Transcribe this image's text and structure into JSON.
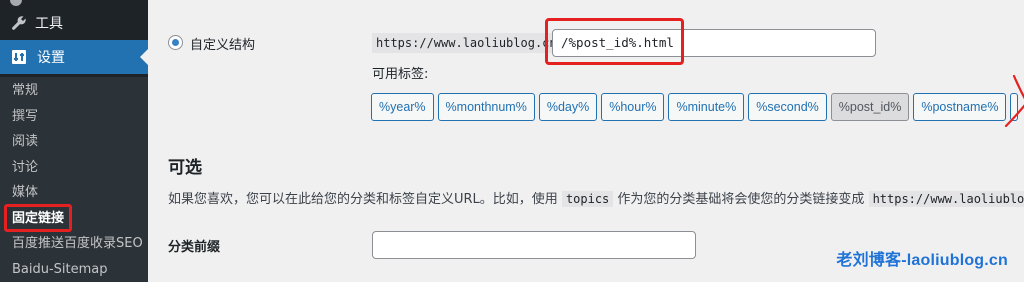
{
  "sidebar": {
    "tools_label": "工具",
    "settings_label": "设置",
    "items": [
      {
        "label": "常规"
      },
      {
        "label": "撰写"
      },
      {
        "label": "阅读"
      },
      {
        "label": "讨论"
      },
      {
        "label": "媒体"
      },
      {
        "label": "固定链接"
      },
      {
        "label": "百度推送百度收录SEO"
      },
      {
        "label": "Baidu-Sitemap"
      }
    ],
    "current_index": 5
  },
  "permalink": {
    "option_label": "自定义结构",
    "url_prefix": "https://www.laoliublog.cn",
    "structure_value": "/%post_id%.html",
    "tags_label": "可用标签:",
    "tags": [
      "%year%",
      "%monthnum%",
      "%day%",
      "%hour%",
      "%minute%",
      "%second%",
      "%post_id%",
      "%postname%"
    ],
    "active_tag": "%post_id%"
  },
  "optional": {
    "title": "可选",
    "desc_before": "如果您喜欢，您可以在此给您的分类和标签自定义URL。比如，使用 ",
    "desc_code1": "topics",
    "desc_middle": " 作为您的分类基础将会使您的分类链接变成 ",
    "desc_code2": "https://www.laoliublog.cn/topics/uncategorized/",
    "category_base_label": "分类前缀",
    "category_base_value": ""
  },
  "watermark": "老刘博客-laoliublog.cn",
  "colors": {
    "sidebar_bg": "#1d2327",
    "active_menu": "#2271b1",
    "annotation_red": "#e52020",
    "link_blue": "#2271b1"
  }
}
